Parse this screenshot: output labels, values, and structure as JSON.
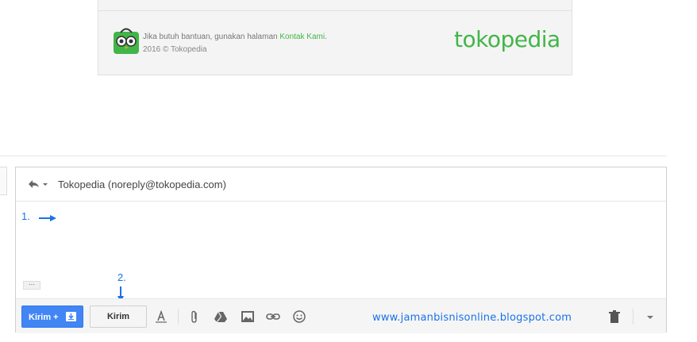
{
  "email_footer": {
    "help_text": "Jika butuh bantuan, gunakan halaman ",
    "help_link": "Kontak Kami",
    "help_end": ".",
    "copyright": "2016 © Tokopedia",
    "brand": "tokopedia",
    "brand_color": "#42b549"
  },
  "compose": {
    "recipient": "Tokopedia (noreply@tokopedia.com)",
    "step1_label": "1.",
    "step2_label": "2.",
    "ellipsis": "···",
    "send_more_label": "Kirim +",
    "send_label": "Kirim",
    "watermark": "www.jamanbisnisonline.blogspot.com",
    "accent": "#4285f4",
    "annotation_color": "#1a73e8"
  },
  "icons": [
    "reply-icon",
    "dropdown-caret-icon",
    "owl-mascot-icon",
    "schedule-send-icon",
    "text-format-icon",
    "attach-icon",
    "drive-icon",
    "image-icon",
    "link-icon",
    "emoji-icon",
    "trash-icon",
    "more-options-icon"
  ]
}
